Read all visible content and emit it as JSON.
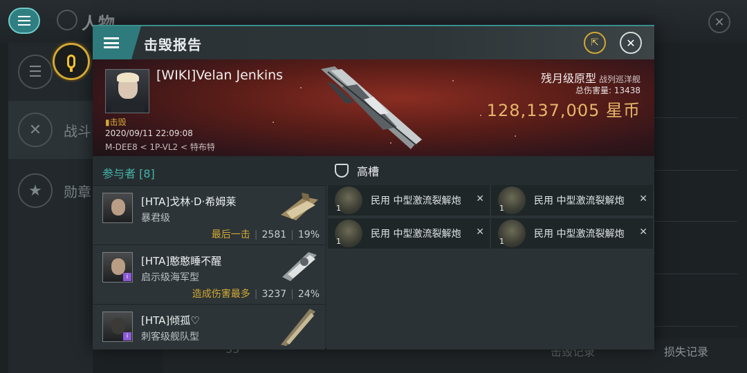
{
  "background": {
    "title": "人物",
    "sidebar": [
      {
        "label": "",
        "icon": "menu-icon"
      },
      {
        "label": "战斗",
        "icon": "crossed-swords-icon"
      },
      {
        "label": "勋章",
        "icon": "star-hexagon-icon"
      }
    ],
    "bottom": {
      "count": "33",
      "kill_records": "击毁记录",
      "loss_records": "损失记录"
    }
  },
  "dialog": {
    "title": "击毁报告",
    "share_icon": "share-icon",
    "close_icon": "close-icon"
  },
  "victim": {
    "name": "[WIKI]Velan Jenkins",
    "status": "击毁",
    "datetime": "2020/09/11 22:09:08",
    "location": "M-DEE8 < 1P-VL2 < 特布特",
    "ship_class": "残月级原型",
    "ship_type": "战列巡洋舰",
    "total_damage_label": "总伤害量:",
    "total_damage": "13438",
    "isk_value": "128,137,005",
    "isk_unit": "星币"
  },
  "participants": {
    "header": "参与者 [8]",
    "items": [
      {
        "name": "[HTA]戈林·D·希姆莱",
        "ship": "暴君级",
        "tag": "最后一击",
        "damage": "2581",
        "percent": "19%"
      },
      {
        "name": "[HTA]憨憨睡不醒",
        "ship": "启示级海军型",
        "tag": "造成伤害最多",
        "damage": "3237",
        "percent": "24%"
      },
      {
        "name": "[HTA]倾孤♡",
        "ship": "刺客级舰队型",
        "tag": "",
        "damage": "",
        "percent": ""
      }
    ]
  },
  "fittings": {
    "header": "高槽",
    "items": [
      {
        "name": "民用 中型激流裂解炮",
        "qty": "1"
      },
      {
        "name": "民用 中型激流裂解炮",
        "qty": "1"
      },
      {
        "name": "民用 中型激流裂解炮",
        "qty": "1"
      },
      {
        "name": "民用 中型激流裂解炮",
        "qty": "1"
      }
    ]
  },
  "colors": {
    "accent_teal": "#2f7a7c",
    "gold": "#d4a934",
    "isk": "#e7b66a"
  }
}
